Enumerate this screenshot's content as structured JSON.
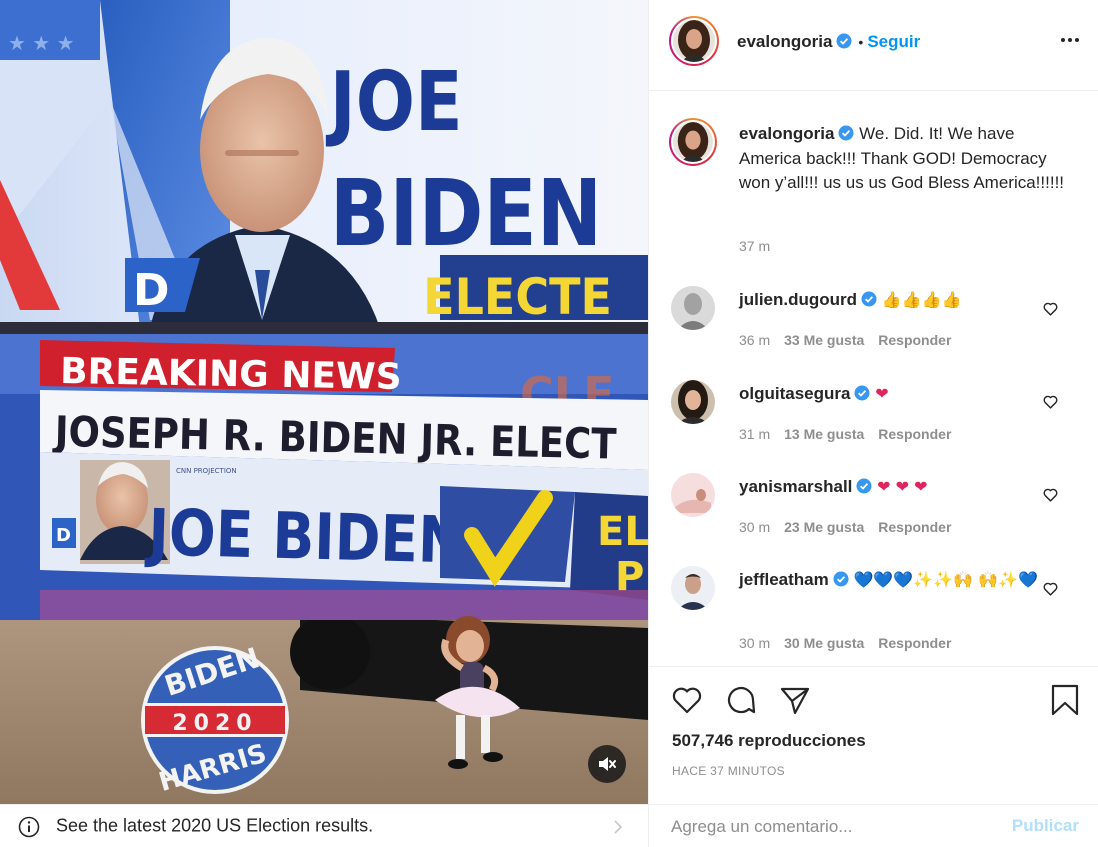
{
  "media": {
    "tv": {
      "name_first": "JOE",
      "name_last": "BIDEN",
      "party": "D",
      "elected_partial": "ELECTE",
      "breaking": "BREAKING NEWS",
      "headline": "JOSEPH R. BIDEN JR. ELECT",
      "banner_name": "JOE BIDEN",
      "banner_small": "CNN PROJECTION",
      "banner_party": "D",
      "banner_side": "EL P",
      "ghost": "CLE"
    },
    "sticker": {
      "top": "BIDEN",
      "year": "2020",
      "bottom": "HARRIS"
    }
  },
  "infobar": {
    "text": "See the latest 2020 US Election results."
  },
  "header": {
    "username": "evalongoria",
    "separator": "•",
    "follow": "Seguir"
  },
  "caption": {
    "username": "evalongoria",
    "text": "We. Did. It! We have America back!!! Thank GOD! Democracy won y’all!!! us us us God Bless America!!!!!!",
    "time": "37 m"
  },
  "comments": [
    {
      "username": "julien.dugourd",
      "emoji": "👍👍👍👍",
      "time": "36 m",
      "likes": "33 Me gusta",
      "reply": "Responder"
    },
    {
      "username": "olguitasegura",
      "emoji": "❤",
      "time": "31 m",
      "likes": "13 Me gusta",
      "reply": "Responder"
    },
    {
      "username": "yanismarshall",
      "emoji": "❤ ❤ ❤",
      "time": "30 m",
      "likes": "23 Me gusta",
      "reply": "Responder"
    },
    {
      "username": "jeffleatham",
      "emoji": "💙💙💙✨✨🙌 🙌✨💙",
      "time": "30 m",
      "likes": "30 Me gusta",
      "reply": "Responder"
    }
  ],
  "stats": {
    "views": "507,746 reproducciones",
    "ago": "HACE 37 MINUTOS"
  },
  "comment_box": {
    "placeholder": "Agrega un comentario...",
    "publish": "Publicar"
  },
  "colors": {
    "link": "#0095f6",
    "publish_disabled": "#b2dffc",
    "muted": "#8e8e8e",
    "heart_red": "#e0245e",
    "heart_blue": "#1d8fe1"
  },
  "icons": [
    "info-icon",
    "chevron-right-icon",
    "mute-icon",
    "verified-badge-icon",
    "more-options-icon",
    "heart-icon",
    "comment-icon",
    "share-icon",
    "bookmark-icon"
  ]
}
